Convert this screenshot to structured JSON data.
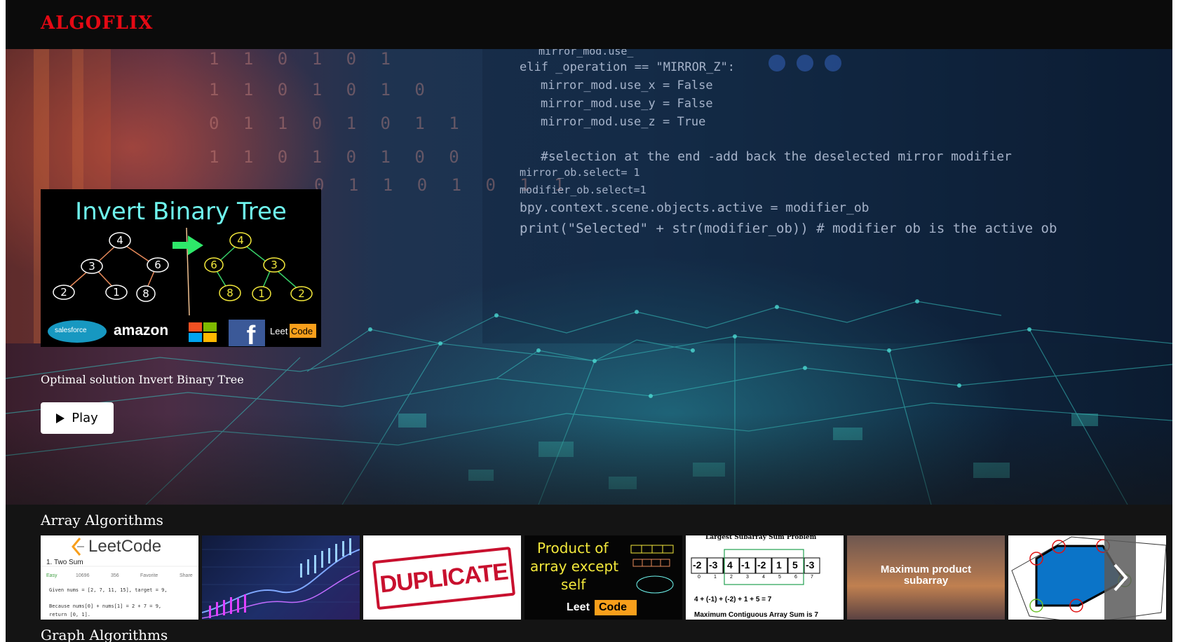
{
  "brand": {
    "logo": "ALGOFLIX"
  },
  "hero": {
    "code_lines": [
      "mirror_mod.use_",
      "elif _operation == \"MIRROR_Z\":",
      "mirror_mod.use_x = False",
      "mirror_mod.use_y = False",
      "mirror_mod.use_z = True",
      "#selection at the end -add back the deselected mirror modifier",
      "mirror_ob.select= 1",
      "modifier_ob.select=1",
      "bpy.context.scene.objects.active = modifier_ob",
      "print(\"Selected\" + str(modifier_ob)) # modifier ob is the active ob"
    ],
    "binary_lines": [
      "1 1 0 1 0 1",
      "1 1 0 1 0 1 0",
      "0 1 1 0 1 0 1 1",
      "1 1 0 1 0 1 0 0",
      "0 1 1 0 1 0 1 1"
    ],
    "feature": {
      "title": "Invert Binary Tree",
      "left_tree": [
        "4",
        "3",
        "6",
        "2",
        "1",
        "8"
      ],
      "right_tree": [
        "4",
        "6",
        "3",
        "8",
        "1",
        "2"
      ],
      "brands": {
        "salesforce": "salesforce",
        "amazon": "amazon",
        "leet": "Leet",
        "code": "Code"
      }
    },
    "description": "Optimal solution Invert Binary Tree",
    "play_label": "Play"
  },
  "rows": [
    {
      "title": "Array Algorithms",
      "tiles": {
        "leetcode": {
          "logo": "LeetCode",
          "problem": "1. Two Sum",
          "difficulty": "Easy",
          "likes": "10696",
          "dislikes": "356",
          "favorite": "Favorite",
          "share": "Share",
          "line1": "Given nums = [2, 7, 11, 15], target = 9,",
          "line2": "Because nums[0] + nums[1] = 2 + 7 = 9,",
          "line3": "return [0, 1]."
        },
        "duplicate": {
          "stamp": "DUPLICATE"
        },
        "product": {
          "line1": "Product of",
          "line2": "array except",
          "line3": "self",
          "leet": "Leet",
          "code": "Code"
        },
        "subarray": {
          "title": "Largest Subarray Sum Problem",
          "values": [
            "-2",
            "-3",
            "4",
            "-1",
            "-2",
            "1",
            "5",
            "-3"
          ],
          "indices": [
            "0",
            "1",
            "2",
            "3",
            "4",
            "5",
            "6",
            "7"
          ],
          "equation": "4 + (-1) + (-2) + 1 + 5 = 7",
          "result": "Maximum Contiguous Array Sum is 7"
        },
        "max_product": {
          "line1": "Maximum product",
          "line2": "subarray"
        }
      }
    },
    {
      "title": "Graph Algorithms"
    }
  ],
  "colors": {
    "brand_red": "#e50914",
    "tree_cyan": "#6ff5ee",
    "leet_orange": "#f89f1b"
  }
}
